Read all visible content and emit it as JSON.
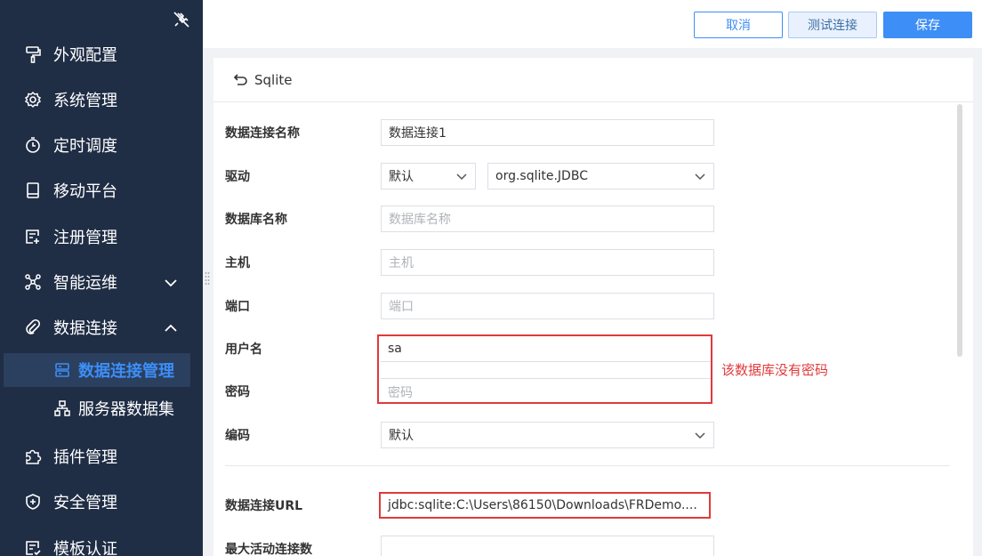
{
  "sidebar": {
    "items": [
      {
        "label": "外观配置",
        "icon": "paint-roller-icon"
      },
      {
        "label": "系统管理",
        "icon": "gear-icon"
      },
      {
        "label": "定时调度",
        "icon": "stopwatch-icon"
      },
      {
        "label": "移动平台",
        "icon": "tablet-icon"
      },
      {
        "label": "注册管理",
        "icon": "register-icon"
      },
      {
        "label": "智能运维",
        "icon": "network-icon",
        "expanded": false
      },
      {
        "label": "数据连接",
        "icon": "link-icon",
        "expanded": true
      },
      {
        "label": "插件管理",
        "icon": "puzzle-icon"
      },
      {
        "label": "安全管理",
        "icon": "shield-icon"
      },
      {
        "label": "模板认证",
        "icon": "template-icon"
      }
    ],
    "subitems": [
      {
        "label": "数据连接管理",
        "icon": "database-icon",
        "active": true
      },
      {
        "label": "服务器数据集",
        "icon": "server-dataset-icon",
        "active": false
      }
    ]
  },
  "toolbar": {
    "cancel_label": "取消",
    "test_label": "测试连接",
    "save_label": "保存"
  },
  "panel": {
    "title": "Sqlite",
    "fields": {
      "conn_name": {
        "label": "数据连接名称",
        "value": "数据连接1"
      },
      "driver": {
        "label": "驱动",
        "mode": "默认",
        "value": "org.sqlite.JDBC"
      },
      "db_name": {
        "label": "数据库名称",
        "placeholder": "数据库名称"
      },
      "host": {
        "label": "主机",
        "placeholder": "主机"
      },
      "port": {
        "label": "端口",
        "placeholder": "端口"
      },
      "username": {
        "label": "用户名",
        "value": "sa"
      },
      "password": {
        "label": "密码",
        "placeholder": "密码"
      },
      "encoding": {
        "label": "编码",
        "value": "默认"
      },
      "url": {
        "label": "数据连接URL",
        "value": "jdbc:sqlite:C:\\Users\\86150\\Downloads\\FRDemo...."
      },
      "max_active": {
        "label": "最大活动连接数"
      }
    },
    "annotation": "该数据库没有密码"
  },
  "colors": {
    "sidebar_bg": "#1f2d45",
    "accent": "#3d8ef6",
    "annotation": "#e03a3a"
  }
}
